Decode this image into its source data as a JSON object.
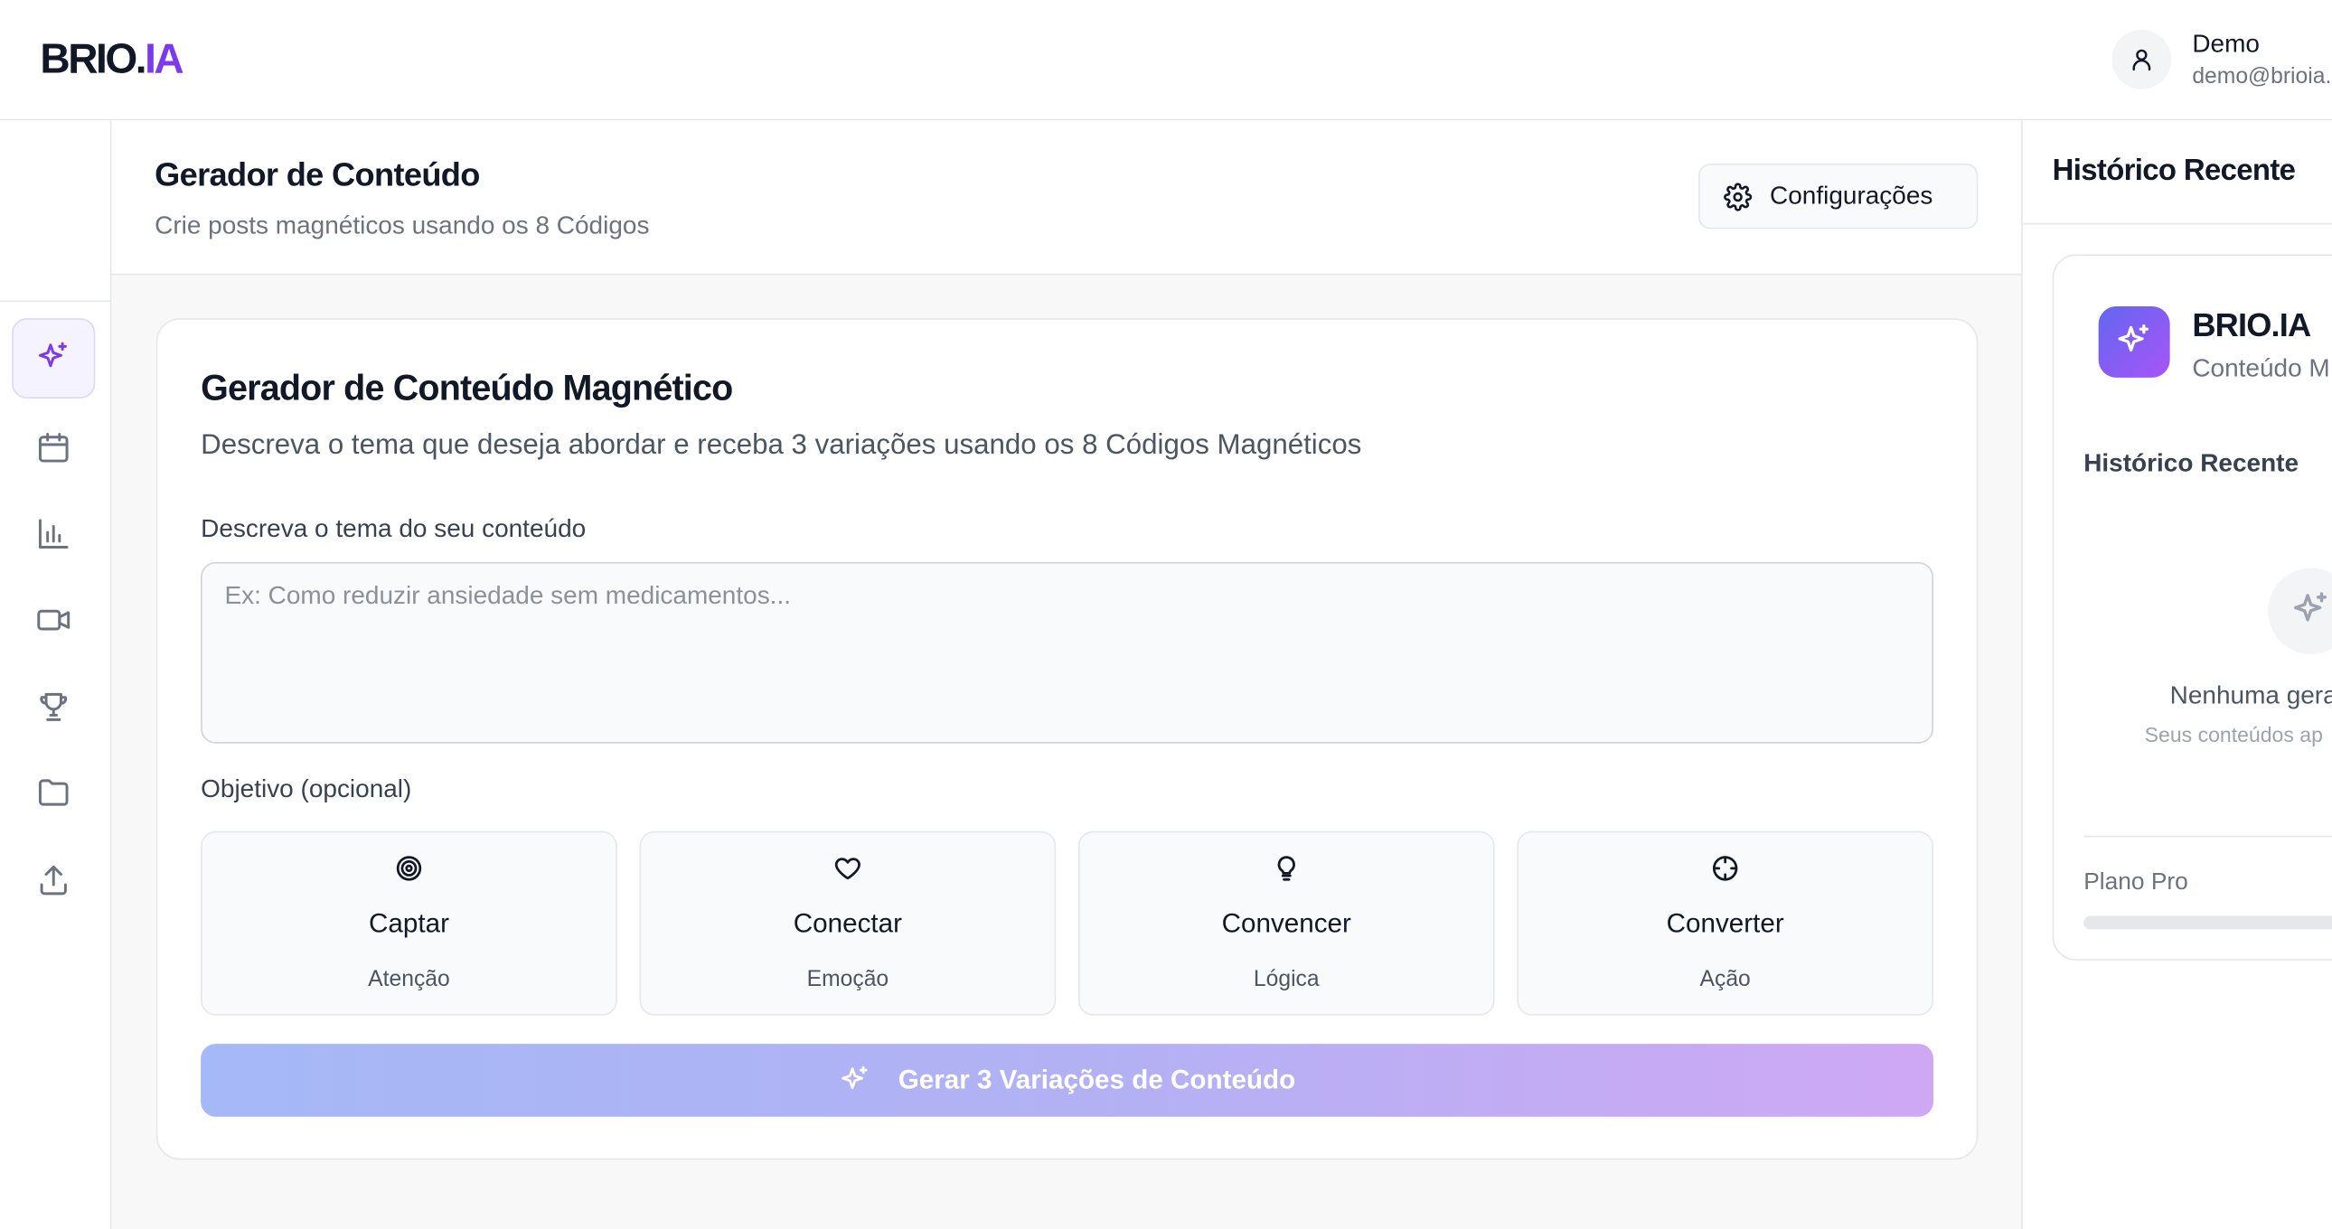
{
  "app": {
    "logo_main": "BRIO.",
    "logo_accent": "IA",
    "accent_color": "#7c3aed"
  },
  "user": {
    "name": "Demo",
    "email": "demo@brioia."
  },
  "sidebar": {
    "items": [
      {
        "name": "sparkles-icon",
        "active": true
      },
      {
        "name": "calendar-icon",
        "active": false
      },
      {
        "name": "bar-chart-icon",
        "active": false
      },
      {
        "name": "video-icon",
        "active": false
      },
      {
        "name": "trophy-icon",
        "active": false
      },
      {
        "name": "folder-icon",
        "active": false
      },
      {
        "name": "upload-icon",
        "active": false
      }
    ]
  },
  "header": {
    "title": "Gerador de Conteúdo",
    "subtitle": "Crie posts magnéticos usando os 8 Códigos",
    "settings_label": "Configurações"
  },
  "generator": {
    "title": "Gerador de Conteúdo Magnético",
    "description": "Descreva o tema que deseja abordar e receba 3 variações usando os 8 Códigos Magnéticos",
    "topic_label": "Descreva o tema do seu conteúdo",
    "topic_placeholder": "Ex: Como reduzir ansiedade sem medicamentos...",
    "topic_value": "",
    "goal_label": "Objetivo (opcional)",
    "goals": [
      {
        "title": "Captar",
        "subtitle": "Atenção",
        "icon": "target-icon"
      },
      {
        "title": "Conectar",
        "subtitle": "Emoção",
        "icon": "heart-icon"
      },
      {
        "title": "Convencer",
        "subtitle": "Lógica",
        "icon": "lightbulb-icon"
      },
      {
        "title": "Converter",
        "subtitle": "Ação",
        "icon": "crosshair-icon"
      }
    ],
    "generate_label": "Gerar 3 Variações de Conteúdo"
  },
  "history_panel": {
    "header_title": "Histórico Recente",
    "brand": "BRIO.IA",
    "brand_sub": "Conteúdo M",
    "section_title": "Histórico Recente",
    "empty_title": "Nenhuma gera",
    "empty_sub": "Seus conteúdos ap",
    "plan_label": "Plano Pro",
    "plan_usage": 0
  }
}
